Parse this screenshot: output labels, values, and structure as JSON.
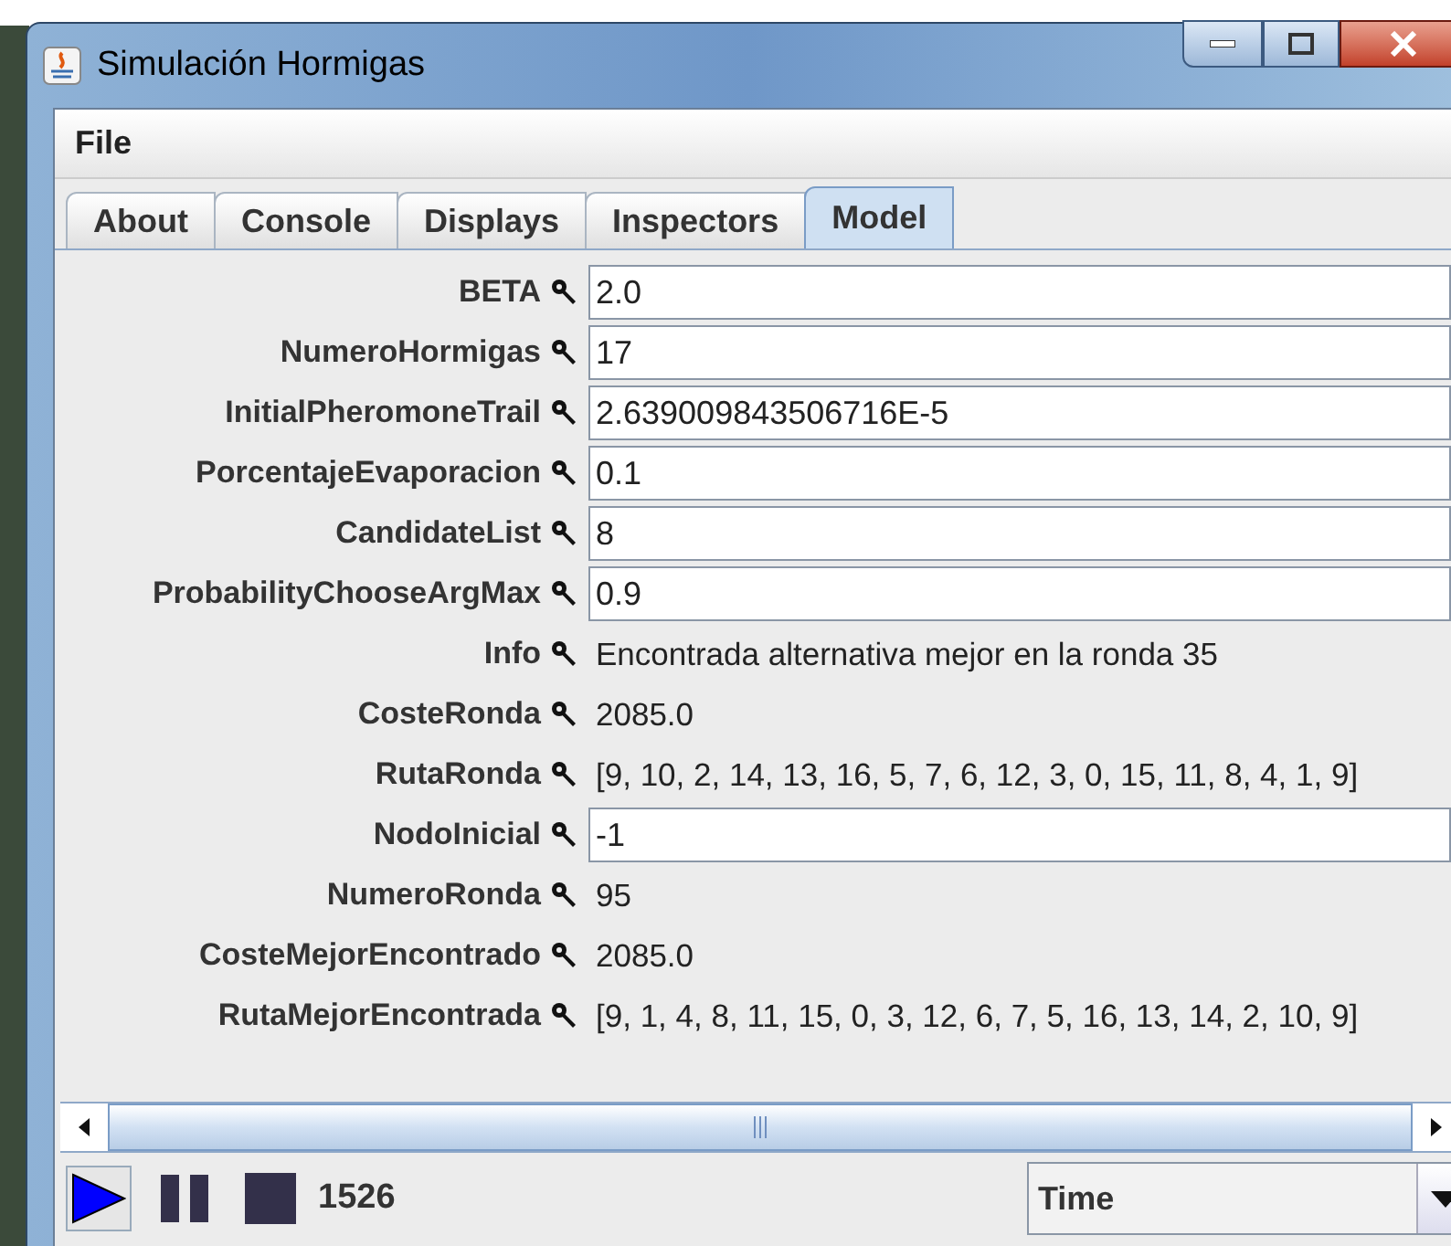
{
  "window": {
    "title": "Simulación Hormigas"
  },
  "menu": [
    "File"
  ],
  "tabs": [
    {
      "label": "About",
      "selected": false
    },
    {
      "label": "Console",
      "selected": false
    },
    {
      "label": "Displays",
      "selected": false
    },
    {
      "label": "Inspectors",
      "selected": false
    },
    {
      "label": "Model",
      "selected": true
    }
  ],
  "properties": [
    {
      "name": "BETA",
      "kind": "field",
      "value": "2.0"
    },
    {
      "name": "NumeroHormigas",
      "kind": "field",
      "value": "17"
    },
    {
      "name": "InitialPheromoneTrail",
      "kind": "field",
      "value": "2.639009843506716E-5"
    },
    {
      "name": "PorcentajeEvaporacion",
      "kind": "field",
      "value": "0.1"
    },
    {
      "name": "CandidateList",
      "kind": "field",
      "value": "8"
    },
    {
      "name": "ProbabilityChooseArgMax",
      "kind": "field",
      "value": "0.9"
    },
    {
      "name": "Info",
      "kind": "text",
      "value": "Encontrada alternativa mejor en la ronda 35"
    },
    {
      "name": "CosteRonda",
      "kind": "text",
      "value": "2085.0"
    },
    {
      "name": "RutaRonda",
      "kind": "text",
      "value": "[9, 10, 2, 14, 13, 16, 5, 7, 6, 12, 3, 0, 15, 11, 8, 4, 1, 9]"
    },
    {
      "name": "NodoInicial",
      "kind": "field",
      "value": "-1"
    },
    {
      "name": "NumeroRonda",
      "kind": "text",
      "value": "95"
    },
    {
      "name": "CosteMejorEncontrado",
      "kind": "text",
      "value": "2085.0"
    },
    {
      "name": "RutaMejorEncontrada",
      "kind": "text",
      "value": "[9, 1, 4, 8, 11, 15, 0, 3, 12, 6, 7, 5, 16, 13, 14, 2, 10, 9]"
    }
  ],
  "toolbar": {
    "steps": "1526",
    "time_select": "Time"
  }
}
